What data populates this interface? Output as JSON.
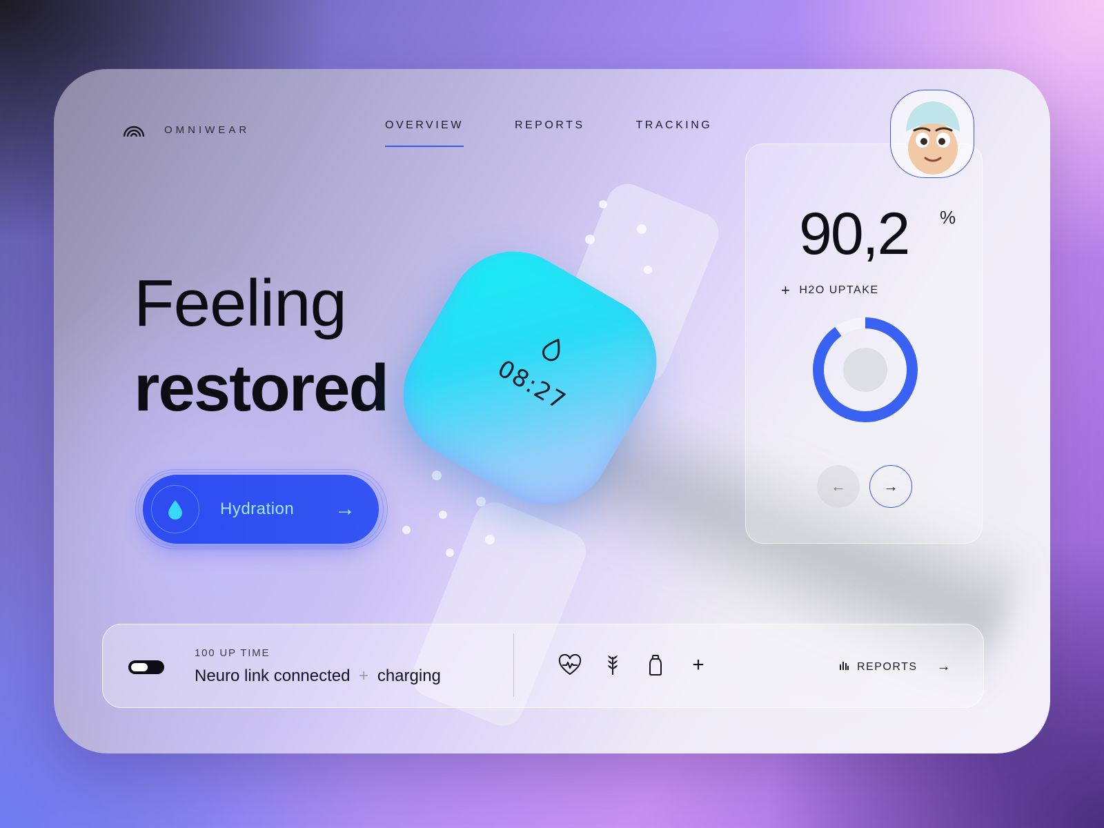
{
  "brand": {
    "name": "OMNIWEAR",
    "icon": "omniwear-logo-icon"
  },
  "nav": {
    "items": [
      {
        "label": "OVERVIEW",
        "active": true
      },
      {
        "label": "REPORTS",
        "active": false
      },
      {
        "label": "TRACKING",
        "active": false
      }
    ]
  },
  "hero": {
    "line1": "Feeling",
    "line2": "restored"
  },
  "hydration_button": {
    "label": "Hydration",
    "icon": "water-drop-icon",
    "arrow": "→"
  },
  "watch": {
    "time": "08:27",
    "icon": "water-drop-icon"
  },
  "metric": {
    "value": "90,2",
    "unit": "%",
    "plus": "+",
    "label": "H2O UPTAKE",
    "ring_fraction": 0.902
  },
  "pager": {
    "prev": "←",
    "next": "→"
  },
  "status": {
    "uptime": "100 UP TIME",
    "text_before": "Neuro link connected",
    "sep": "+",
    "text_after": "charging"
  },
  "quick_icons": [
    "heart-rate-icon",
    "wheat-icon",
    "bottle-icon",
    "plus-icon"
  ],
  "quick_icons_plus": "+",
  "reports_link": {
    "label": "REPORTS",
    "arrow": "→",
    "icon": "bar-chart-icon"
  },
  "colors": {
    "accent": "#3a55ea",
    "button": "#2d4bf0",
    "watch": "#18f0f5"
  }
}
